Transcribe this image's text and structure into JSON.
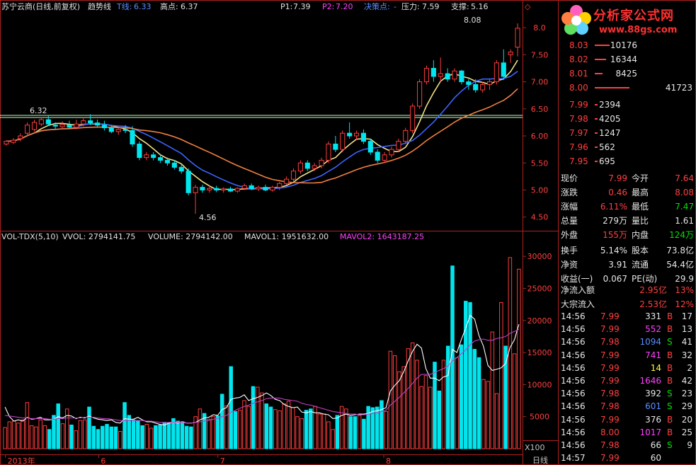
{
  "header": {
    "stock": "苏宁云商(日线,前复权)",
    "indicator": "趋势线",
    "t_line_label": "T线:",
    "t_line_value": "6.33",
    "high_label": "高点:",
    "high_value": "6.37",
    "p1_label": "P1:",
    "p1_value": "7.39",
    "p2_label": "P2:",
    "p2_value": "7.20",
    "decision_label": "决策点:",
    "decision_value": "-",
    "resistance_label": "压力:",
    "resistance_value": "7.59",
    "support_label": "支撑:",
    "support_value": "5.16"
  },
  "volume_header": {
    "name": "VOL-TDX(5,10)",
    "vvol": "VVOL: 2794141.75",
    "volume": "VOLUME: 2794142.00",
    "mavol1": "MAVOL1: 1951632.00",
    "mavol2": "MAVOL2: 1643187.25"
  },
  "annotations": {
    "high_mark": "8.08",
    "low_mark": "4.56",
    "line_mark": "6.32",
    "multiplier": "X100",
    "period": "日线"
  },
  "colors": {
    "up": "#ff3c3c",
    "down": "#00e5ee",
    "ma_fast": "#f0e08a",
    "ma_slow": "#f08040",
    "ma_blue": "#3c64ff",
    "mavol1": "#ffffff",
    "mavol2": "#c040c0",
    "axis": "#b02020",
    "hline": "#c0ffc0"
  },
  "chart_data": [
    {
      "type": "candlestick",
      "title": "苏宁云商(日线,前复权)",
      "ylim": [
        4.3,
        8.25
      ],
      "y_ticks": [
        "8.0",
        "7.50",
        "7.00",
        "6.50",
        "6.00",
        "5.50",
        "5.00",
        "4.50"
      ],
      "x_ticks": [
        "2013年",
        "6",
        "7",
        "8"
      ],
      "ohlc": [
        [
          5.85,
          5.92,
          5.82,
          5.9
        ],
        [
          5.88,
          5.96,
          5.85,
          5.92
        ],
        [
          5.95,
          6.05,
          5.9,
          6.0
        ],
        [
          6.05,
          6.25,
          6.0,
          6.2
        ],
        [
          6.12,
          6.3,
          6.08,
          6.25
        ],
        [
          6.22,
          6.35,
          6.18,
          6.3
        ],
        [
          6.3,
          6.37,
          6.18,
          6.22
        ],
        [
          6.2,
          6.25,
          6.12,
          6.18
        ],
        [
          6.17,
          6.27,
          6.13,
          6.21
        ],
        [
          6.2,
          6.28,
          6.14,
          6.16
        ],
        [
          6.16,
          6.3,
          6.12,
          6.22
        ],
        [
          6.22,
          6.35,
          6.18,
          6.28
        ],
        [
          6.28,
          6.4,
          6.2,
          6.24
        ],
        [
          6.24,
          6.3,
          6.15,
          6.2
        ],
        [
          6.2,
          6.28,
          6.1,
          6.15
        ],
        [
          6.15,
          6.2,
          6.05,
          6.08
        ],
        [
          6.08,
          6.15,
          6.02,
          6.12
        ],
        [
          6.12,
          6.2,
          6.05,
          6.1
        ],
        [
          6.1,
          6.18,
          5.8,
          5.85
        ],
        [
          5.85,
          5.9,
          5.55,
          5.6
        ],
        [
          5.6,
          5.7,
          5.55,
          5.65
        ],
        [
          5.65,
          5.7,
          5.55,
          5.6
        ],
        [
          5.6,
          5.65,
          5.5,
          5.55
        ],
        [
          5.55,
          5.6,
          5.45,
          5.5
        ],
        [
          5.5,
          5.55,
          5.38,
          5.42
        ],
        [
          5.42,
          5.48,
          5.3,
          5.35
        ],
        [
          5.35,
          5.4,
          4.9,
          4.95
        ],
        [
          4.95,
          5.1,
          4.56,
          5.05
        ],
        [
          5.05,
          5.1,
          4.95,
          5.0
        ],
        [
          5.0,
          5.08,
          4.95,
          5.03
        ],
        [
          5.03,
          5.08,
          4.96,
          5.0
        ],
        [
          5.0,
          5.05,
          4.95,
          5.02
        ],
        [
          5.02,
          5.06,
          4.96,
          4.98
        ],
        [
          4.98,
          5.05,
          4.95,
          5.03
        ],
        [
          5.03,
          5.12,
          5.0,
          5.08
        ],
        [
          5.08,
          5.12,
          5.0,
          5.02
        ],
        [
          5.02,
          5.08,
          4.98,
          5.05
        ],
        [
          5.05,
          5.1,
          4.98,
          5.0
        ],
        [
          5.0,
          5.08,
          4.97,
          5.05
        ],
        [
          5.05,
          5.15,
          5.0,
          5.12
        ],
        [
          5.12,
          5.25,
          5.1,
          5.2
        ],
        [
          5.2,
          5.4,
          5.15,
          5.35
        ],
        [
          5.35,
          5.55,
          5.3,
          5.5
        ],
        [
          5.5,
          5.55,
          5.35,
          5.4
        ],
        [
          5.4,
          5.5,
          5.35,
          5.45
        ],
        [
          5.45,
          5.6,
          5.4,
          5.55
        ],
        [
          5.55,
          5.9,
          5.5,
          5.85
        ],
        [
          5.85,
          6.0,
          5.7,
          5.75
        ],
        [
          5.75,
          6.1,
          5.7,
          6.05
        ],
        [
          6.05,
          6.25,
          5.95,
          6.0
        ],
        [
          6.0,
          6.1,
          5.92,
          6.05
        ],
        [
          6.05,
          6.12,
          5.85,
          5.9
        ],
        [
          5.9,
          5.95,
          5.65,
          5.7
        ],
        [
          5.7,
          5.75,
          5.5,
          5.55
        ],
        [
          5.55,
          5.7,
          5.5,
          5.65
        ],
        [
          5.65,
          5.8,
          5.6,
          5.75
        ],
        [
          5.75,
          5.95,
          5.7,
          5.9
        ],
        [
          5.9,
          6.15,
          5.85,
          6.1
        ],
        [
          6.1,
          6.6,
          6.05,
          6.55
        ],
        [
          6.55,
          7.05,
          6.5,
          7.0
        ],
        [
          7.0,
          7.3,
          6.95,
          7.25
        ],
        [
          7.25,
          7.4,
          7.0,
          7.1
        ],
        [
          7.1,
          7.45,
          7.0,
          7.15
        ],
        [
          7.15,
          7.25,
          7.0,
          7.05
        ],
        [
          7.05,
          7.25,
          7.0,
          7.2
        ],
        [
          7.2,
          7.22,
          6.95,
          7.0
        ],
        [
          7.0,
          7.05,
          6.85,
          6.95
        ],
        [
          6.95,
          7.05,
          6.8,
          6.85
        ],
        [
          6.85,
          7.0,
          6.8,
          6.95
        ],
        [
          6.95,
          7.05,
          6.85,
          7.0
        ],
        [
          7.0,
          7.4,
          6.95,
          7.35
        ],
        [
          7.35,
          7.6,
          7.05,
          7.1
        ],
        [
          7.5,
          7.6,
          7.35,
          7.55
        ],
        [
          7.64,
          8.08,
          7.47,
          7.99
        ]
      ]
    },
    {
      "type": "bar",
      "title": "VOL-TDX(5,10)",
      "ylim": [
        0,
        32000
      ],
      "y_ticks": [
        "30000",
        "25000",
        "20000",
        "15000",
        "10000",
        "5000"
      ],
      "values": [
        3300,
        4200,
        4300,
        4000,
        4500,
        7200,
        3600,
        3400,
        4500,
        3600,
        3000,
        5200,
        7000,
        3900,
        6200,
        3700,
        2800,
        4400,
        4500,
        6500,
        3500,
        3000,
        3500,
        3800,
        3400,
        3400,
        2700,
        7200,
        5200,
        4500,
        4400,
        3600,
        3800,
        3200,
        3600,
        3700,
        4100,
        4000,
        4700,
        4300,
        4200,
        3500,
        3400,
        5000,
        6200,
        5500,
        4600,
        5000,
        5100,
        8500,
        6700,
        12800,
        5800,
        6000,
        7500,
        6600,
        9700,
        9600,
        8700,
        7000,
        6500,
        6100,
        5900,
        7000,
        7400,
        6400,
        5000,
        4700,
        6000,
        6200,
        6600,
        5400,
        5400,
        4200,
        3000,
        5200,
        6600,
        6200,
        5000,
        5000,
        5200,
        4600,
        6600,
        6400,
        6500,
        7500,
        5800,
        15200,
        14500,
        12000,
        12800,
        15600,
        16500,
        13800,
        9700,
        11400,
        9600,
        13500,
        9000,
        13800,
        16000,
        28500,
        14200,
        16200,
        23000,
        22800,
        15500,
        14200,
        10800,
        10500,
        18200,
        8600,
        22800,
        16000,
        29800,
        14800,
        28000
      ],
      "mavol1": [
        6500,
        5000,
        4300,
        4500,
        4300,
        4900,
        4600,
        4700,
        4900,
        4500,
        4500,
        4600,
        5000,
        4800,
        5200,
        5100,
        4700,
        4900,
        4800,
        5100,
        4800,
        4600,
        4500,
        4400,
        4500,
        4100,
        4000,
        4700,
        4600,
        4600,
        4900,
        4500,
        4200,
        4200,
        4000,
        3800,
        3700,
        4000,
        4100,
        4000,
        4200,
        4000,
        4000,
        4100,
        4500,
        4800,
        4900,
        5300,
        5200,
        6100,
        6400,
        7700,
        7900,
        8000,
        8400,
        7500,
        7800,
        8000,
        8300,
        8700,
        8300,
        7700,
        7500,
        6900,
        6600,
        6400,
        6500,
        5700,
        5600,
        5800,
        5600,
        5600,
        5400,
        5300,
        4700,
        4800,
        5200,
        5400,
        5200,
        5300,
        5400,
        5400,
        5500,
        5800,
        5900,
        6100,
        6400,
        9000,
        9900,
        10600,
        12000,
        13700,
        15200,
        16300,
        15700,
        12500,
        11000,
        11000,
        10600,
        11200,
        11400,
        15500,
        15000,
        17000,
        18800,
        20800,
        20200,
        17600,
        16000,
        13000,
        12200,
        12400,
        12600,
        13300,
        15800,
        17000,
        19400
      ],
      "mavol2": [
        5200,
        5100,
        5000,
        4900,
        4800,
        4800,
        4700,
        4700,
        4700,
        4700,
        4600,
        4600,
        4700,
        4700,
        4800,
        4800,
        4800,
        4800,
        4900,
        4900,
        4900,
        4800,
        4700,
        4700,
        4600,
        4500,
        4400,
        4400,
        4400,
        4400,
        4400,
        4400,
        4300,
        4300,
        4200,
        4100,
        4100,
        4100,
        4100,
        4100,
        4100,
        4000,
        4000,
        4100,
        4200,
        4300,
        4400,
        4600,
        4700,
        5000,
        5200,
        5700,
        6000,
        6300,
        6600,
        6800,
        7100,
        7300,
        7500,
        7800,
        7900,
        7900,
        7900,
        7700,
        7600,
        7500,
        7400,
        7100,
        6900,
        6800,
        6600,
        6400,
        6200,
        6000,
        5800,
        5700,
        5600,
        5500,
        5400,
        5400,
        5300,
        5300,
        5400,
        5500,
        5600,
        5800,
        6000,
        6800,
        7400,
        8000,
        8700,
        9400,
        10200,
        11000,
        11600,
        11600,
        11600,
        11900,
        12200,
        12500,
        12900,
        13700,
        14200,
        14800,
        15400,
        16200,
        16800,
        17000,
        17100,
        16900,
        16900,
        17200,
        17300,
        17500,
        18000,
        18300,
        18600
      ]
    }
  ],
  "quote": {
    "asks": [
      [
        "8.03",
        "10176"
      ],
      [
        "8.02",
        "16344"
      ],
      [
        "8.01",
        "8425"
      ],
      [
        "8.00",
        "41723"
      ]
    ],
    "bids": [
      [
        "7.99",
        "2394"
      ],
      [
        "7.98",
        "4205"
      ],
      [
        "7.97",
        "1247"
      ],
      [
        "7.96",
        "562"
      ],
      [
        "7.95",
        "695"
      ]
    ],
    "stats": [
      [
        "现价",
        "7.99",
        "今开",
        "7.64"
      ],
      [
        "涨跌",
        "0.46",
        "最高",
        "8.08"
      ],
      [
        "涨幅",
        "6.11%",
        "最低",
        "7.47"
      ],
      [
        "总量",
        "279万",
        "量比",
        "1.61"
      ],
      [
        "外盘",
        "155万",
        "内盘",
        "124万"
      ],
      [
        "换手",
        "5.14%",
        "股本",
        "73.8亿"
      ],
      [
        "净资",
        "3.91",
        "流通",
        "54.4亿"
      ],
      [
        "收益(一)",
        "0.067",
        "PE(动)",
        "29.9"
      ]
    ],
    "flow": [
      [
        "净流入额",
        "2.95亿",
        "13%"
      ],
      [
        "大宗流入",
        "2.53亿",
        "12%"
      ]
    ],
    "ticks": [
      [
        "14:56",
        "7.99",
        "331",
        "B",
        "17"
      ],
      [
        "14:56",
        "7.99",
        "552",
        "B",
        "13"
      ],
      [
        "14:56",
        "7.98",
        "1094",
        "S",
        "41"
      ],
      [
        "14:56",
        "7.99",
        "741",
        "B",
        "32"
      ],
      [
        "14:56",
        "7.99",
        "14",
        "B",
        "2"
      ],
      [
        "14:56",
        "7.99",
        "1646",
        "B",
        "42"
      ],
      [
        "14:56",
        "7.98",
        "392",
        "S",
        "23"
      ],
      [
        "14:56",
        "7.98",
        "601",
        "S",
        "29"
      ],
      [
        "14:56",
        "7.99",
        "376",
        "B",
        "20"
      ],
      [
        "14:56",
        "8.00",
        "1017",
        "B",
        "25"
      ],
      [
        "14:56",
        "7.98",
        "66",
        "S",
        "9"
      ],
      [
        "14:57",
        "7.99",
        "60",
        "",
        ""
      ]
    ]
  },
  "logo": {
    "brand": "分析家公式网",
    "url": "www.88gs.com"
  }
}
